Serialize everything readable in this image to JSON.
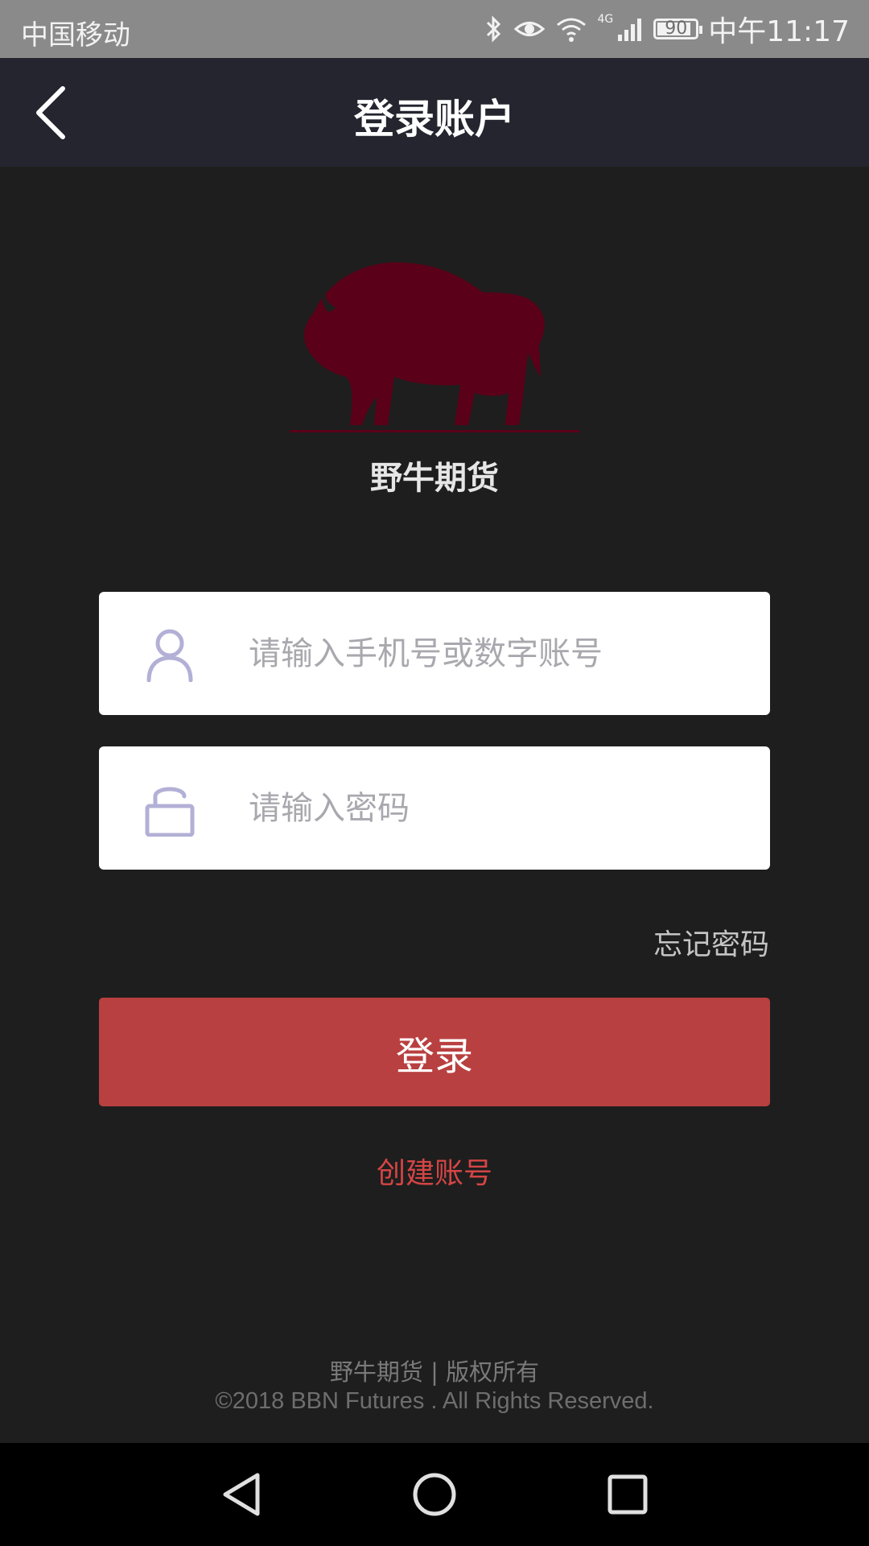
{
  "status_bar": {
    "carrier": "中国移动",
    "network": "4G",
    "battery": "90",
    "time": "中午11:17"
  },
  "header": {
    "title": "登录账户"
  },
  "brand": {
    "name": "野牛期货",
    "logo_color": "#5a0019"
  },
  "form": {
    "account_placeholder": "请输入手机号或数字账号",
    "password_placeholder": "请输入密码",
    "forgot_label": "忘记密码",
    "login_label": "登录",
    "create_label": "创建账号"
  },
  "footer": {
    "line1": "野牛期货 | 版权所有",
    "line2": "©2018 BBN Futures . All Rights Reserved."
  },
  "colors": {
    "accent": "#b94040",
    "link": "#d54545",
    "header_bg": "#252530",
    "page_bg": "#1e1e1e"
  }
}
